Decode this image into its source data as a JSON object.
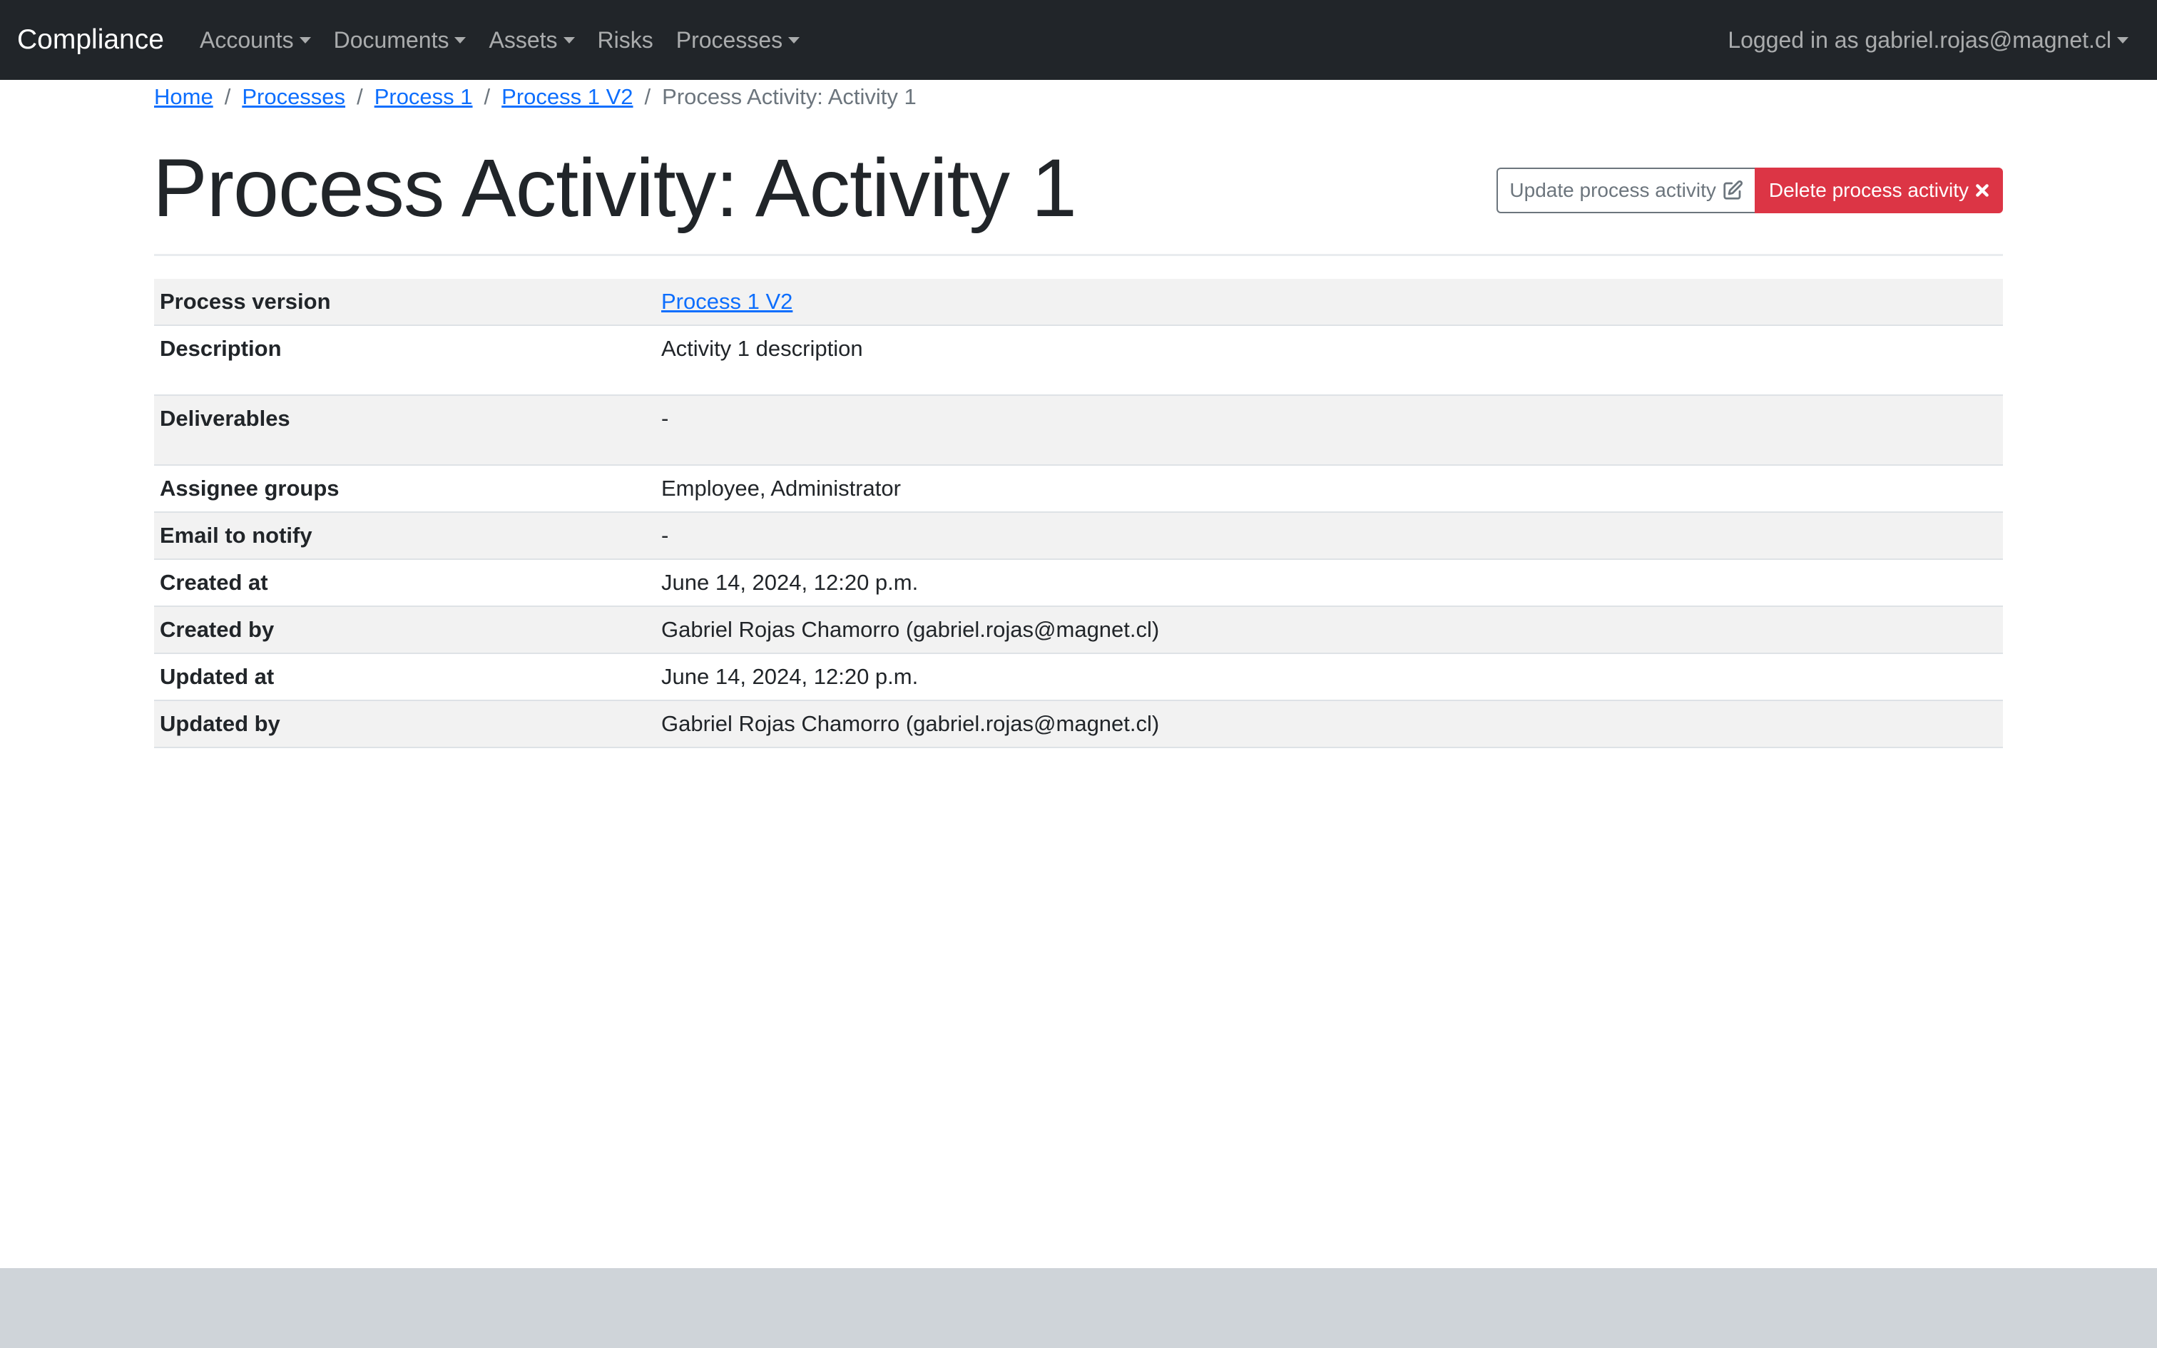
{
  "navbar": {
    "brand": "Compliance",
    "items": [
      {
        "label": "Accounts",
        "dropdown": true
      },
      {
        "label": "Documents",
        "dropdown": true
      },
      {
        "label": "Assets",
        "dropdown": true
      },
      {
        "label": "Risks",
        "dropdown": false
      },
      {
        "label": "Processes",
        "dropdown": true
      }
    ],
    "user_label": "Logged in as gabriel.rojas@magnet.cl"
  },
  "breadcrumb": {
    "items": [
      "Home",
      "Processes",
      "Process 1",
      "Process 1 V2"
    ],
    "current": "Process Activity: Activity 1",
    "separator": "/"
  },
  "page_title": "Process Activity: Activity 1",
  "actions": {
    "update_label": "Update process activity",
    "update_icon": "edit-icon",
    "delete_label": "Delete process activity",
    "delete_icon": "close-icon"
  },
  "details": {
    "process_version": {
      "label": "Process version",
      "value": "Process 1 V2"
    },
    "description": {
      "label": "Description",
      "value": "Activity 1 description"
    },
    "deliverables": {
      "label": "Deliverables",
      "value": "-"
    },
    "assignee_groups": {
      "label": "Assignee groups",
      "value": "Employee, Administrator"
    },
    "email_to_notify": {
      "label": "Email to notify",
      "value": "-"
    },
    "created_at": {
      "label": "Created at",
      "value": "June 14, 2024, 12:20 p.m."
    },
    "created_by": {
      "label": "Created by",
      "value": "Gabriel Rojas Chamorro (gabriel.rojas@magnet.cl)"
    },
    "updated_at": {
      "label": "Updated at",
      "value": "June 14, 2024, 12:20 p.m."
    },
    "updated_by": {
      "label": "Updated by",
      "value": "Gabriel Rojas Chamorro (gabriel.rojas@magnet.cl)"
    }
  },
  "colors": {
    "navbar_bg": "#212529",
    "link": "#0d6efd",
    "danger": "#dc3545",
    "stripe": "#f2f2f2",
    "footer_bg": "#cfd4d9"
  }
}
